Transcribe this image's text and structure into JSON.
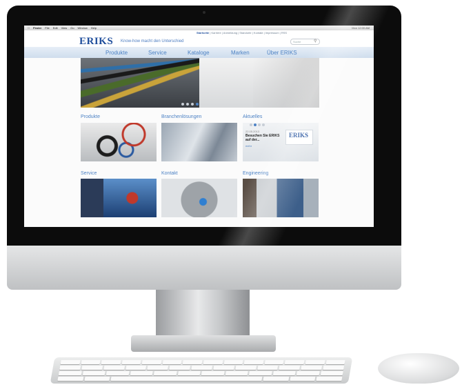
{
  "menubar": {
    "items": [
      "Finder",
      "File",
      "Edit",
      "View",
      "Go",
      "Window",
      "Help"
    ],
    "status": "Mon 12:00 AM"
  },
  "header": {
    "logo": "ERIKS",
    "tagline": "Know-how macht den Unterschied",
    "top_links": [
      "Startseite",
      "Karriere",
      "Anmeldung",
      "Standorte",
      "Kontakt",
      "Impressum",
      "RSS"
    ],
    "search_placeholder": "Suche"
  },
  "nav": {
    "items": [
      "Produkte",
      "Service",
      "Kataloge",
      "Marken",
      "Über ERIKS"
    ]
  },
  "hero": {
    "slide_count": 4,
    "active_slide": 4
  },
  "tiles": {
    "produkte": "Produkte",
    "branchen": "Branchenlösungen",
    "aktuelles": "Aktuelles",
    "service": "Service",
    "kontakt": "Kontakt",
    "engineering": "Engineering"
  },
  "aktuelles": {
    "date": "22.05.2013",
    "text": "Besuchen Sie ERIKS auf der...",
    "more": "mehr",
    "logo": "ERIKS"
  },
  "colors": {
    "brand": "#1f4e9c",
    "accent": "#4d82c4"
  }
}
